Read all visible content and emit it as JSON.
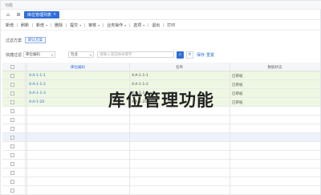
{
  "topbar": {
    "left_label": "功能"
  },
  "tabs": [
    {
      "label": "库位管理列表",
      "active": true,
      "close": "×"
    }
  ],
  "toolbar": {
    "items": [
      {
        "label": "新增",
        "caret": false
      },
      {
        "label": "刷新",
        "caret": false
      },
      {
        "label": "新增",
        "caret": true
      },
      {
        "label": "删除",
        "caret": false
      },
      {
        "label": "提交",
        "caret": true
      },
      {
        "label": "审核",
        "caret": true
      },
      {
        "label": "业务操作",
        "caret": true
      },
      {
        "label": "选项",
        "caret": true
      },
      {
        "label": "退出",
        "caret": false
      },
      {
        "label": "打印",
        "caret": false
      }
    ]
  },
  "filter": {
    "scheme_label": "过滤方案",
    "scheme_chip": "默认方案",
    "field_label": "快捷过滤",
    "field_select": "库位编码",
    "op_select": "包含",
    "search_placeholder": "请输入或选择关键字",
    "search_icon": "search-icon",
    "gear_icon": "gear-icon",
    "save_link": "保存",
    "reset_link": "重置"
  },
  "table": {
    "columns": [
      "库位编码",
      "名称",
      "数据状态"
    ],
    "rows": [
      {
        "code": "X-A-1-1-1",
        "name": "X-A-1-1-1",
        "status": "已审核"
      },
      {
        "code": "X-A-1-1-2",
        "name": "X-A-1-1-2",
        "status": "已审核"
      },
      {
        "code": "X-A-1-1-3",
        "name": "X-A-1-1-3",
        "status": "已审核"
      },
      {
        "code": "X-A-1-20",
        "name": "X-A-1-20",
        "status": "已审核"
      }
    ]
  },
  "overlay_title": "库位管理功能"
}
